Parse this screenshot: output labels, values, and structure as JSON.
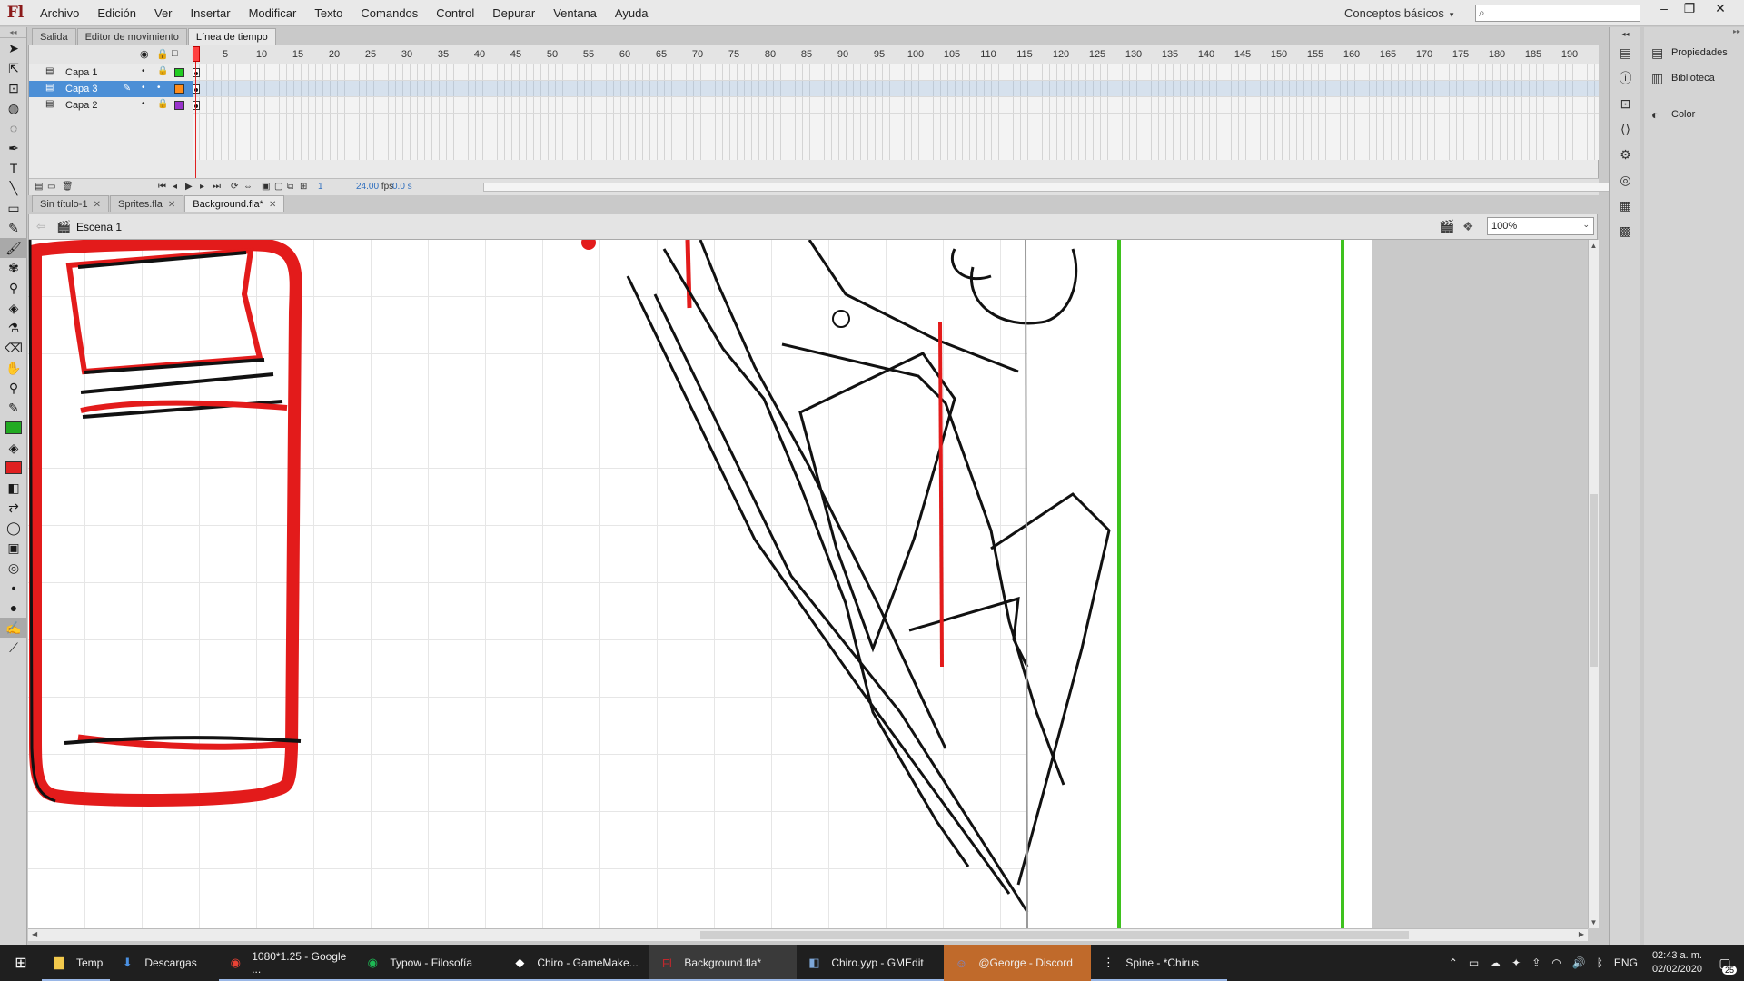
{
  "app": {
    "logo": "Fl",
    "workspace": "Conceptos básicos",
    "search_placeholder": ""
  },
  "menu": [
    "Archivo",
    "Edición",
    "Ver",
    "Insertar",
    "Modificar",
    "Texto",
    "Comandos",
    "Control",
    "Depurar",
    "Ventana",
    "Ayuda"
  ],
  "panel_tabs": [
    {
      "label": "Salida",
      "active": false
    },
    {
      "label": "Editor de movimiento",
      "active": false
    },
    {
      "label": "Línea de tiempo",
      "active": true
    }
  ],
  "timeline": {
    "ruler": [
      "1",
      "5",
      "10",
      "15",
      "20",
      "25",
      "30",
      "35",
      "40",
      "45",
      "50",
      "55",
      "60",
      "65",
      "70",
      "75",
      "80",
      "85",
      "90",
      "95",
      "100",
      "105",
      "110",
      "115",
      "120",
      "125",
      "130",
      "135",
      "140",
      "145",
      "150",
      "155",
      "160",
      "165",
      "170",
      "175",
      "180",
      "185",
      "190"
    ],
    "layers": [
      {
        "name": "Capa 1",
        "color": "#22cc22",
        "selected": false
      },
      {
        "name": "Capa 3",
        "color": "#ff8c1a",
        "selected": true
      },
      {
        "name": "Capa 2",
        "color": "#9933cc",
        "selected": false
      }
    ],
    "current_frame": "1",
    "fps": "24.00",
    "fps_unit": "fps",
    "time": "0.0 s"
  },
  "doc_tabs": [
    {
      "label": "Sin título-1",
      "active": false
    },
    {
      "label": "Sprites.fla",
      "active": false
    },
    {
      "label": "Background.fla*",
      "active": true
    }
  ],
  "edit_bar": {
    "scene": "Escena 1",
    "zoom": "100%"
  },
  "right_panel": [
    {
      "label": "Propiedades",
      "icon": "properties-icon"
    },
    {
      "label": "Biblioteca",
      "icon": "library-icon"
    },
    {
      "label": "Color",
      "icon": "color-icon"
    }
  ],
  "tools": {
    "stroke_color": "#22aa22",
    "fill_color": "#e02020"
  },
  "taskbar": {
    "items": [
      {
        "label": "Temp",
        "icon": "folder-icon",
        "color": "#f2c94c"
      },
      {
        "label": "Descargas",
        "icon": "download-icon",
        "color": "#4a90e2"
      },
      {
        "label": "1080*1.25 - Google ...",
        "icon": "chrome-icon",
        "color": "#e94235"
      },
      {
        "label": "Typow - Filosofía",
        "icon": "spotify-icon",
        "color": "#1db954"
      },
      {
        "label": "Chiro - GameMake...",
        "icon": "gamemaker-icon",
        "color": "#ffffff"
      },
      {
        "label": "Background.fla*",
        "icon": "flash-icon",
        "color": "#c0282d"
      },
      {
        "label": "Chiro.yyp - GMEdit",
        "icon": "gmedit-icon",
        "color": "#7da7d9"
      },
      {
        "label": "@George - Discord",
        "icon": "discord-icon",
        "color": "#7289da"
      },
      {
        "label": "Spine - *Chirus",
        "icon": "spine-icon",
        "color": "#ffffff"
      }
    ],
    "lang": "ENG",
    "time": "02:43 a. m.",
    "date": "02/02/2020",
    "notifications": "25"
  }
}
